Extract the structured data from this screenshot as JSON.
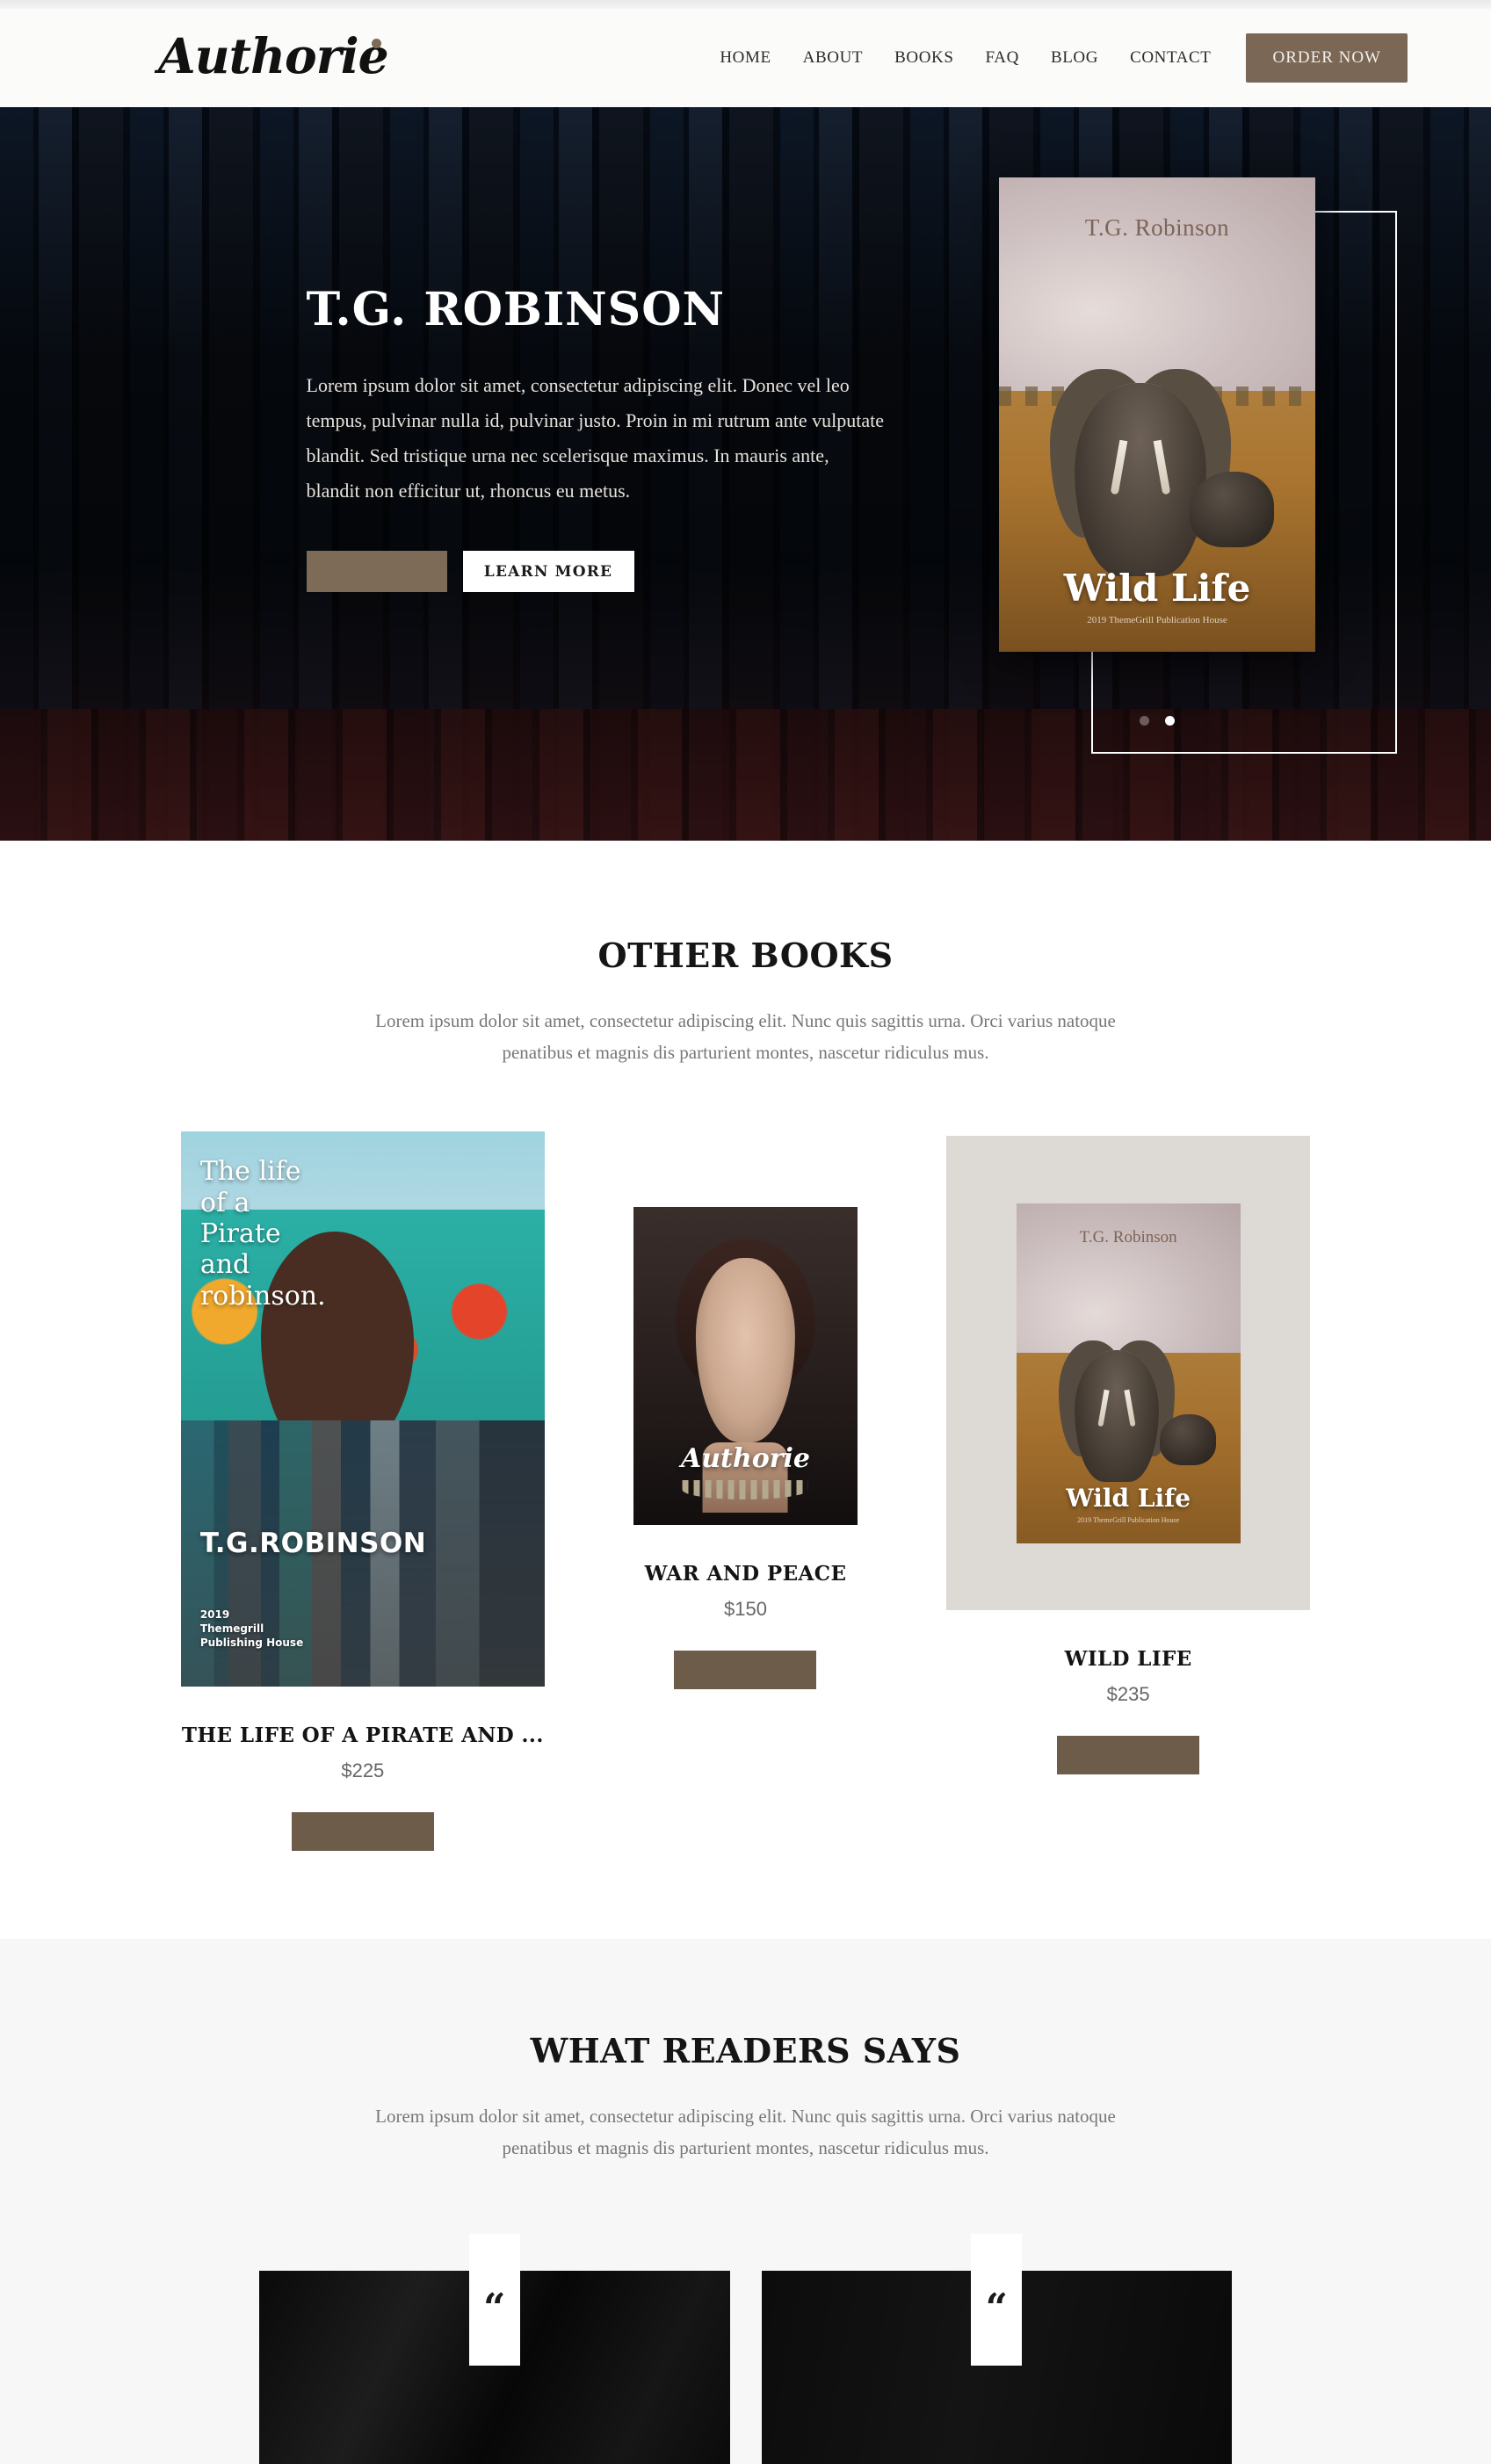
{
  "header": {
    "logo": "Authorie",
    "nav": [
      {
        "label": "HOME"
      },
      {
        "label": "ABOUT"
      },
      {
        "label": "BOOKS"
      },
      {
        "label": "FAQ"
      },
      {
        "label": "BLOG"
      },
      {
        "label": "CONTACT"
      }
    ],
    "order_button": "ORDER NOW"
  },
  "hero": {
    "title": "T.G. ROBINSON",
    "paragraph": "Lorem ipsum dolor sit amet, consectetur adipiscing elit. Donec vel leo tempus, pulvinar nulla id, pulvinar justo. Proin in mi rutrum ante vulputate blandit. Sed tristique urna nec scelerisque maximus. In mauris ante, blandit non efficitur ut, rhoncus eu metus.",
    "primary_button": "",
    "secondary_button": "LEARN MORE",
    "cover": {
      "author": "T.G. Robinson",
      "title": "Wild Life",
      "publisher": "2019 ThemeGrill Publication House"
    },
    "slider_dots": [
      {
        "active": false
      },
      {
        "active": true
      }
    ]
  },
  "books_section": {
    "title": "OTHER BOOKS",
    "subtitle": "Lorem ipsum dolor sit amet, consectetur adipiscing elit. Nunc quis sagittis urna. Orci varius natoque penatibus et magnis dis parturient montes, nascetur ridiculus mus.",
    "books": [
      {
        "name": "THE LIFE OF A PIRATE AND ...",
        "price": "$225",
        "button": "",
        "cover_title": "The life\nof a\nPirate\nand\nrobinson.",
        "cover_author": "T.G.ROBINSON",
        "cover_publisher": "2019\nThemegrill\nPublishing House"
      },
      {
        "name": "WAR AND PEACE",
        "price": "$150",
        "button": "",
        "cover_title": "Authorie"
      },
      {
        "name": "WILD LIFE",
        "price": "$235",
        "button": "",
        "cover_author": "T.G. Robinson",
        "cover_title": "Wild Life",
        "cover_publisher": "2019 ThemeGrill Publication House"
      }
    ]
  },
  "testimonials_section": {
    "title": "WHAT READERS SAYS",
    "subtitle": "Lorem ipsum dolor sit amet, consectetur adipiscing elit. Nunc quis sagittis urna. Orci varius natoque penatibus et magnis dis parturient montes, nascetur ridiculus mus.",
    "cards": [
      {
        "quote_icon": "“"
      },
      {
        "quote_icon": "“"
      }
    ]
  },
  "colors": {
    "accent_brown": "#7a6755",
    "button_brown": "#6e5c4b",
    "dark_text": "#141414",
    "muted_text": "#777777",
    "section_gray": "#f7f7f7"
  }
}
